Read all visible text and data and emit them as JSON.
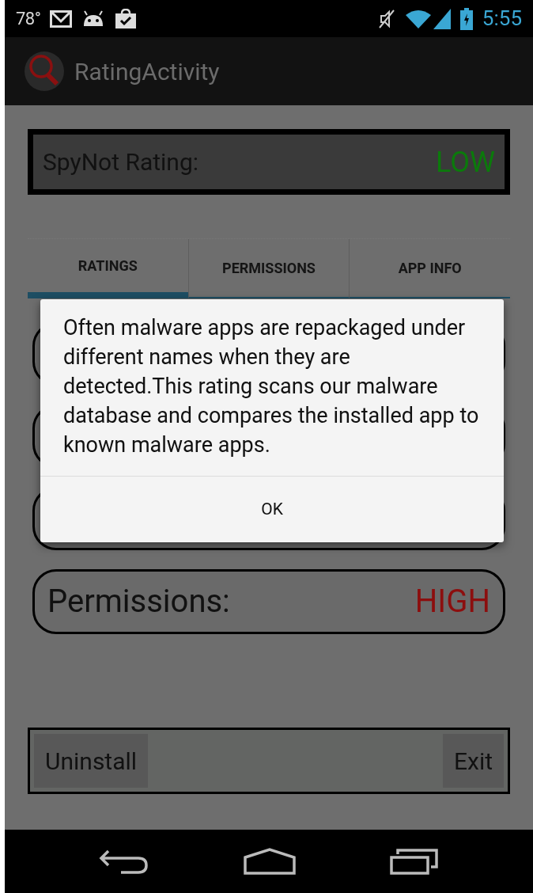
{
  "status_bar": {
    "temperature": "78°",
    "time": "5:55"
  },
  "action_bar": {
    "title": "RatingActivity"
  },
  "spynot_rating": {
    "label": "SpyNot Rating:",
    "value": "LOW",
    "color": "#0b7a0b"
  },
  "tabs": [
    {
      "label": "RATINGS",
      "selected": true
    },
    {
      "label": "PERMISSIONS",
      "selected": false
    },
    {
      "label": "APP INFO",
      "selected": false
    }
  ],
  "rating_rows": [
    {
      "label": "Permissions:",
      "value": "HIGH",
      "color": "#8c0e0e"
    }
  ],
  "dialog": {
    "message": "Often malware apps are repackaged under different names when they are detected.This rating scans our malware database and compares the installed app to known malware apps.",
    "button": "OK"
  },
  "bottom_buttons": [
    "Uninstall",
    "Exit"
  ]
}
